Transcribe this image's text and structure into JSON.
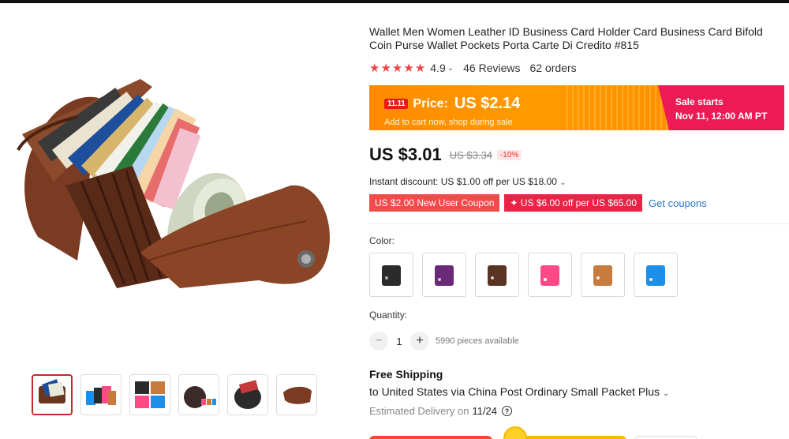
{
  "product": {
    "title": "Wallet Men Women Leather ID Business Card Holder Card Business Card Bifold Coin Purse Wallet Pockets Porta Carte Di Credito #815",
    "rating": "4.9",
    "reviews": "46 Reviews",
    "orders": "62 orders"
  },
  "sale": {
    "badge": "11.11",
    "price_label": "Price:",
    "price_value": "US $2.14",
    "subtext": "Add to cart now, shop during sale",
    "starts_label": "Sale starts",
    "starts_date": "Nov 11, 12:00 AM PT",
    "colors": {
      "banner": "#ff9500",
      "starts_bg": "#ee1a55"
    }
  },
  "pricing": {
    "current": "US $3.01",
    "original": "US $3.34",
    "discount": "-10%",
    "instant_discount": "Instant discount: US $1.00 off per US $18.00"
  },
  "coupons": {
    "items": [
      "US $2.00 New User Coupon",
      "✦ US $6.00 off per US $65.00"
    ],
    "get_label": "Get coupons"
  },
  "variants": {
    "label": "Color:",
    "swatches": [
      {
        "name": "black",
        "color": "#2b2b2b"
      },
      {
        "name": "purple",
        "color": "#6a2a78"
      },
      {
        "name": "coffee",
        "color": "#5a3322"
      },
      {
        "name": "pink",
        "color": "#ff4a86"
      },
      {
        "name": "brown",
        "color": "#c97a3d"
      },
      {
        "name": "blue",
        "color": "#1e8fe8"
      }
    ]
  },
  "quantity": {
    "label": "Quantity:",
    "value": "1",
    "available": "5990 pieces available"
  },
  "shipping": {
    "title": "Free Shipping",
    "line": "to United States via China Post Ordinary Small Packet Plus",
    "delivery_label": "Estimated Delivery on",
    "delivery_date": "11/24"
  }
}
